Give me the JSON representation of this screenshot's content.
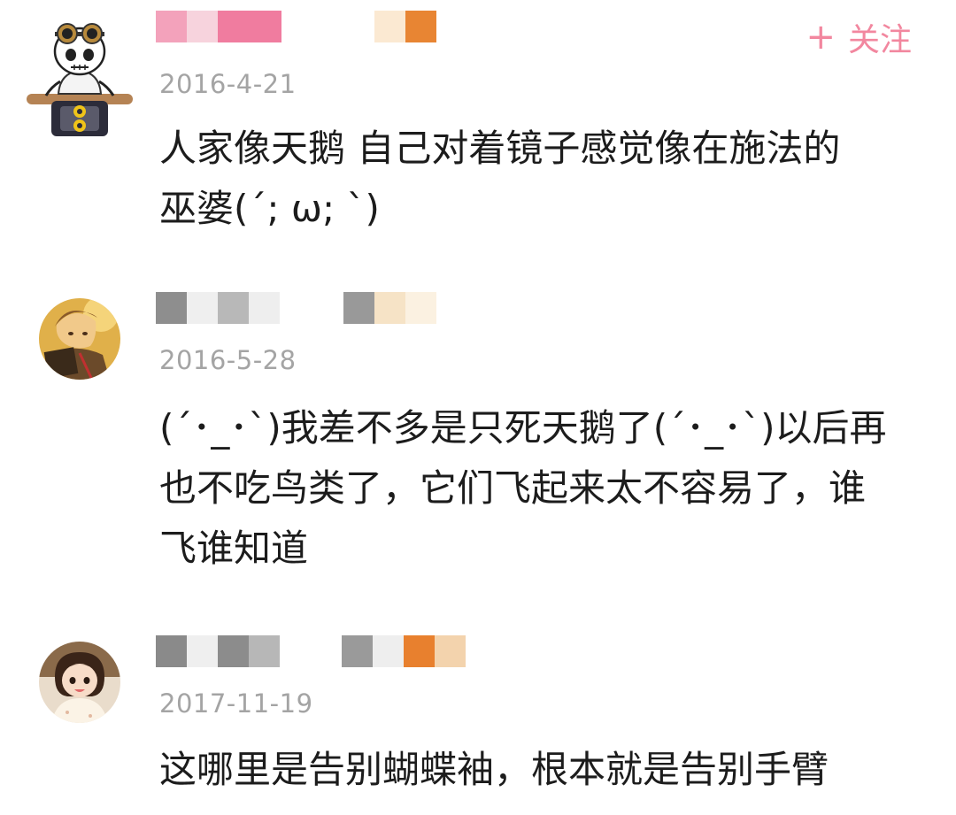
{
  "follow": {
    "icon": "plus-icon",
    "label": "关注",
    "color": "#f2879f"
  },
  "comments": [
    {
      "avatar": "skull-robot-avatar",
      "name_colors": [
        "#f3a2bb",
        "#f7d3dd",
        "#f07c9f",
        "#ffffff",
        "#ffffff",
        "#ffffff",
        "#fbe9d2",
        "#e88533"
      ],
      "date": "2016-4-21",
      "lines": [
        "人家像天鹅 自己对着镜子感觉像在施法的",
        "巫婆(´; ω; `)"
      ]
    },
    {
      "avatar": "anime-boy-avatar",
      "name_colors": [
        "#8e8e8e",
        "#efefef",
        "#b8b8b8",
        "#eeeeee",
        "#ffffff",
        "#ffffff",
        "#999999",
        "#f6e3c6",
        "#fbf1e1"
      ],
      "date": "2016-5-28",
      "lines": [
        "(´･_･`)我差不多是只死天鹅了(´･_･`)以后再",
        "也不吃鸟类了，它们飞起来太不容易了，谁",
        "飞谁知道"
      ]
    },
    {
      "avatar": "anime-girl-avatar",
      "name_colors": [
        "#8a8a8a",
        "#efefef",
        "#8c8c8c",
        "#b7b7b7",
        "#ffffff",
        "#ffffff",
        "#9a9a9a",
        "#eeeeee",
        "#e8802e",
        "#f3d3ad"
      ],
      "date": "2017-11-19",
      "lines": [
        "这哪里是告别蝴蝶袖，根本就是告别手臂"
      ]
    }
  ]
}
